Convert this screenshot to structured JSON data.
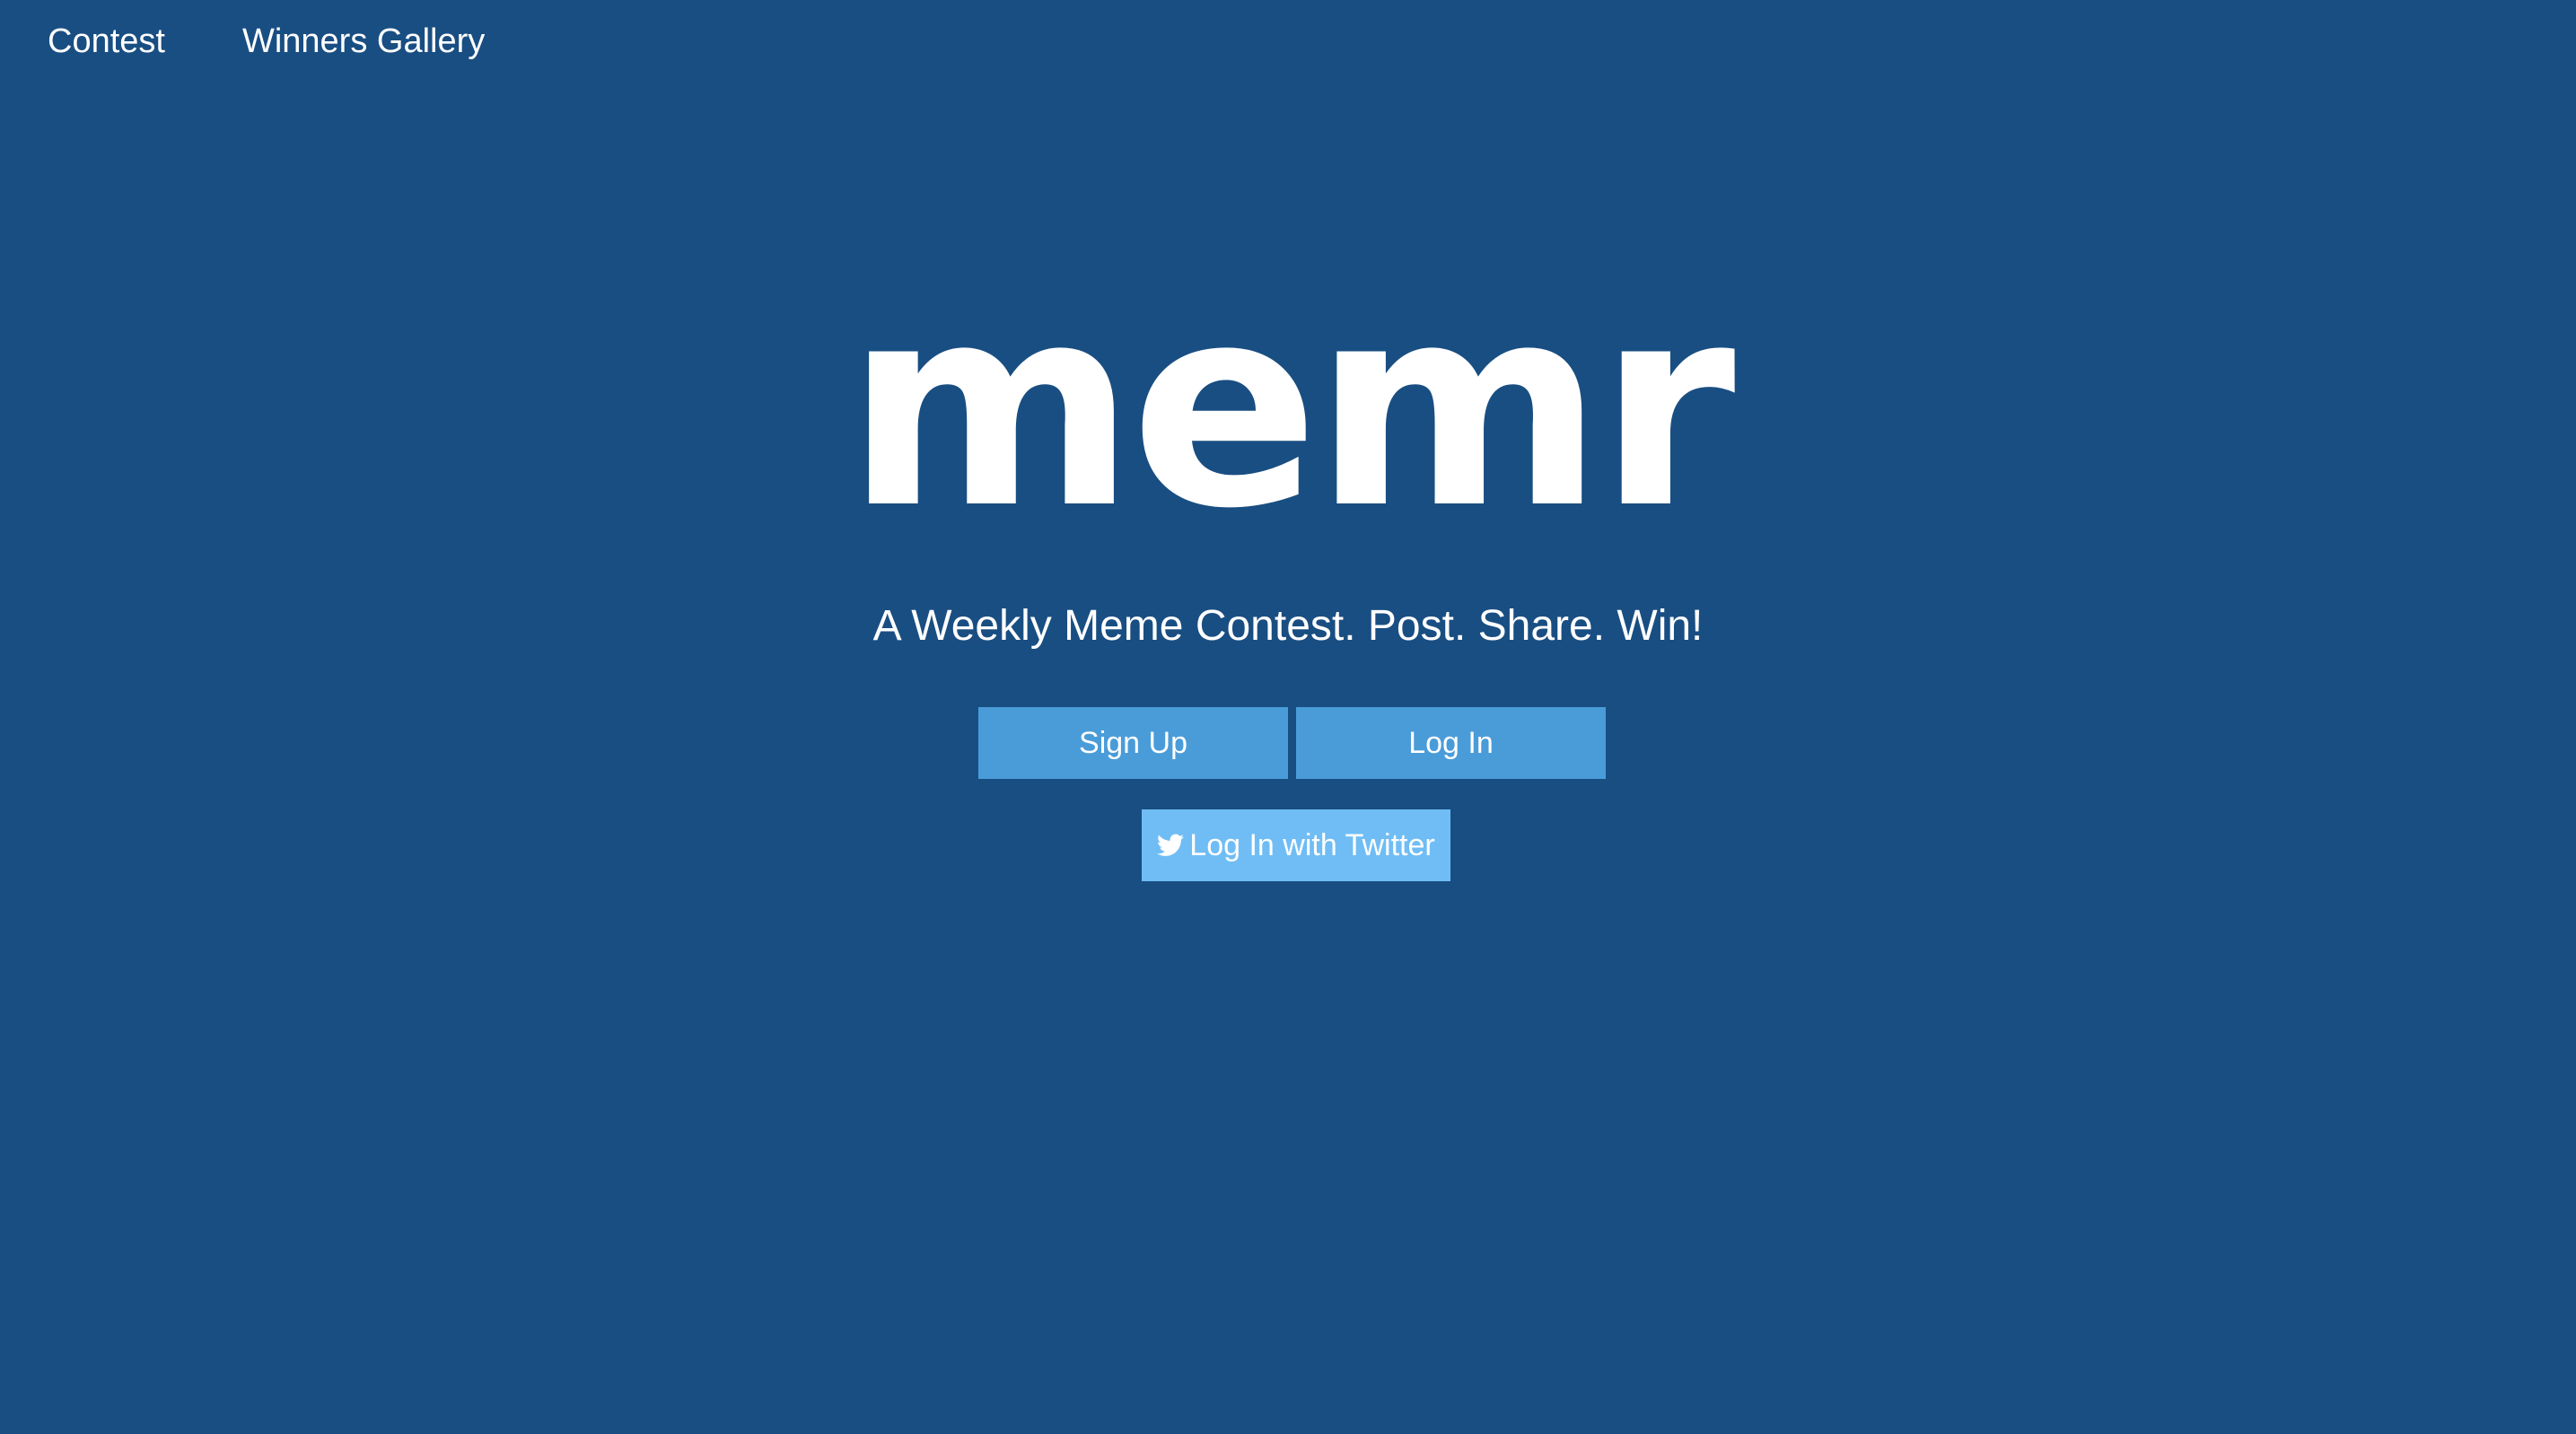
{
  "nav": {
    "items": [
      {
        "label": "Contest"
      },
      {
        "label": "Winners Gallery"
      }
    ]
  },
  "hero": {
    "logo_text": "memr",
    "tagline": "A Weekly Meme Contest. Post. Share. Win!"
  },
  "auth": {
    "signup_label": "Sign Up",
    "login_label": "Log In",
    "twitter_label": "Log In with Twitter",
    "twitter_icon": "twitter-bird-icon"
  },
  "colors": {
    "background": "#194e82",
    "primary_button": "#4a9cd9",
    "twitter_button": "#70bdf5",
    "text": "#ffffff"
  }
}
